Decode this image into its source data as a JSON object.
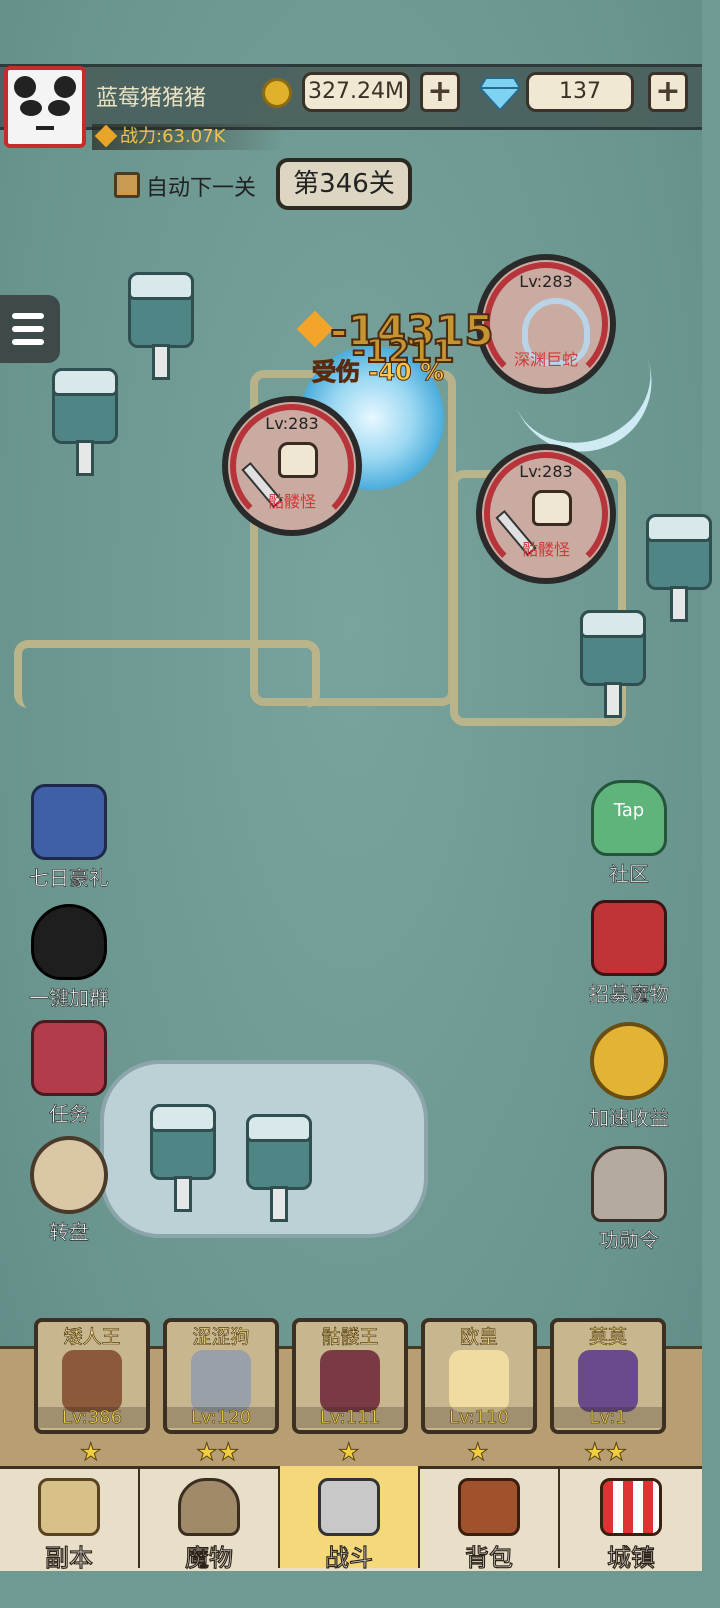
{
  "player": {
    "name": "蓝莓猪猪猪",
    "power": "战力:63.07K"
  },
  "currency": {
    "gold": "327.24M",
    "gems": "137",
    "plus": "+"
  },
  "stage": {
    "auto_next_label": "自动下一关",
    "stage_label": "第346关"
  },
  "battle": {
    "damage_1": "-14315",
    "damage_2": "-1211",
    "buff_text": "受伤 -40 %",
    "enemies": [
      {
        "level": "Lv:283",
        "name": "深渊巨蛇"
      },
      {
        "level": "Lv:283",
        "name": "骷髅怪"
      },
      {
        "level": "Lv:283",
        "name": "骷髅怪"
      }
    ]
  },
  "left_menu": [
    {
      "label": "七日豪礼",
      "icon": "helmet-gift-icon"
    },
    {
      "label": "一键加群",
      "icon": "qq-penguin-icon"
    },
    {
      "label": "任务",
      "icon": "quest-book-icon"
    },
    {
      "label": "转盘",
      "icon": "roulette-wheel-icon"
    }
  ],
  "right_menu": [
    {
      "label": "社区",
      "icon": "tap-community-icon",
      "badge": "Tap"
    },
    {
      "label": "招募魔物",
      "icon": "recruit-banner-icon"
    },
    {
      "label": "加速收益",
      "icon": "coin-boost-icon"
    },
    {
      "label": "功勋令",
      "icon": "knight-helmet-icon"
    }
  ],
  "heroes": [
    {
      "name": "矮人王",
      "level": "Lv:386",
      "stars": "★"
    },
    {
      "name": "涩涩狗",
      "level": "Lv:120",
      "stars": "★★"
    },
    {
      "name": "骷髅王",
      "level": "Lv:111",
      "stars": "★"
    },
    {
      "name": "欧皇",
      "level": "Lv:110",
      "stars": "★"
    },
    {
      "name": "莫莫",
      "level": "Lv:1",
      "stars": "★★"
    }
  ],
  "nav": [
    {
      "label": "副本",
      "icon": "map-scroll-icon"
    },
    {
      "label": "魔物",
      "icon": "monster-helmet-icon"
    },
    {
      "label": "战斗",
      "icon": "crossed-swords-icon",
      "active": true
    },
    {
      "label": "背包",
      "icon": "backpack-icon"
    },
    {
      "label": "城镇",
      "icon": "town-shop-icon"
    }
  ],
  "colors": {
    "accent": "#f6d87c",
    "enemy_ring": "#b6343a",
    "gold_text": "#f1c24a"
  }
}
